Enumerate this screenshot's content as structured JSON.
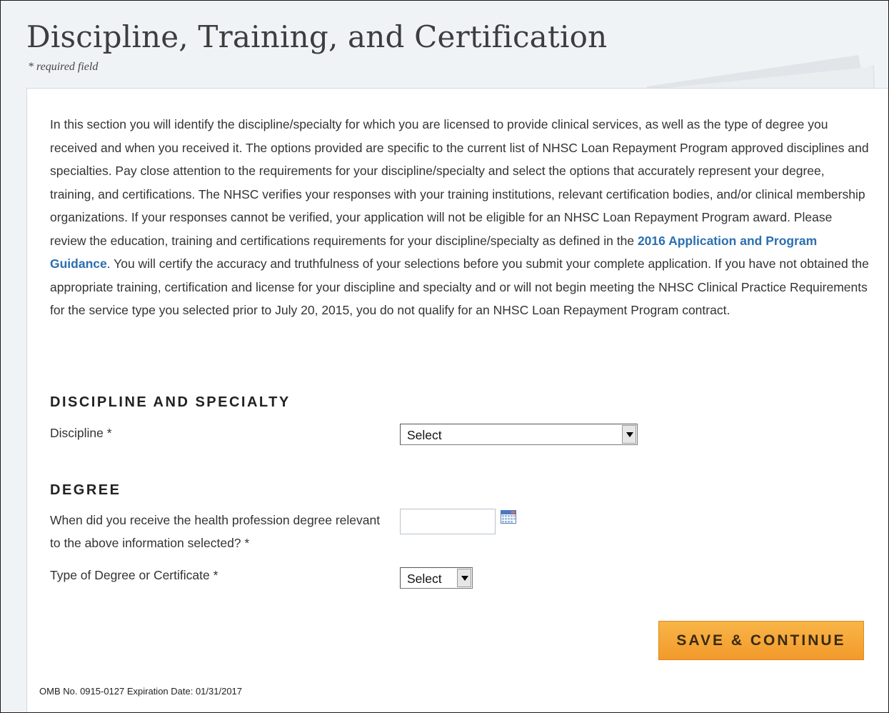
{
  "page": {
    "title": "Discipline, Training, and Certification",
    "required_note": "* required field"
  },
  "intro": {
    "text_before_link": "In this section you will identify the discipline/specialty for which you are licensed to provide clinical services, as well as the type of degree you received and when you received it. The options provided are specific to the current list of NHSC Loan Repayment Program approved disciplines and specialties. Pay close attention to the requirements for your discipline/specialty and select the options that accurately represent your degree, training, and certifications. The NHSC verifies your responses with your training institutions, relevant certification bodies, and/or clinical membership organizations. If your responses cannot be verified, your application will not be eligible for an NHSC Loan Repayment Program award. Please review the education, training and certifications requirements for your discipline/specialty as defined in the ",
    "link_text": "2016 Application and Program Guidance",
    "text_after_link": ". You will certify the accuracy and truthfulness of your selections before you submit your complete application. If you have not obtained the appropriate training, certification and license for your discipline and specialty and or will not begin meeting the NHSC Clinical Practice Requirements for the service type you selected prior to July 20, 2015, you do not qualify for an NHSC Loan Repayment Program contract."
  },
  "discipline_section": {
    "heading": "DISCIPLINE AND SPECIALTY",
    "discipline_label": "Discipline *",
    "discipline_value": "Select"
  },
  "degree_section": {
    "heading": "DEGREE",
    "date_label": "When did you receive the health profession degree relevant to the above information selected? *",
    "date_value": "",
    "type_label": "Type of Degree or Certificate *",
    "type_value": "Select"
  },
  "actions": {
    "save_label": "SAVE & CONTINUE"
  },
  "footer": {
    "omb_text": "OMB No. 0915-0127 Expiration Date: 01/31/2017"
  },
  "icons": {
    "calendar": "calendar-icon",
    "dropdown": "chevron-down-icon"
  },
  "colors": {
    "link": "#2a6fb0",
    "button": "#f5a83a",
    "background": "#f0f3f6"
  }
}
